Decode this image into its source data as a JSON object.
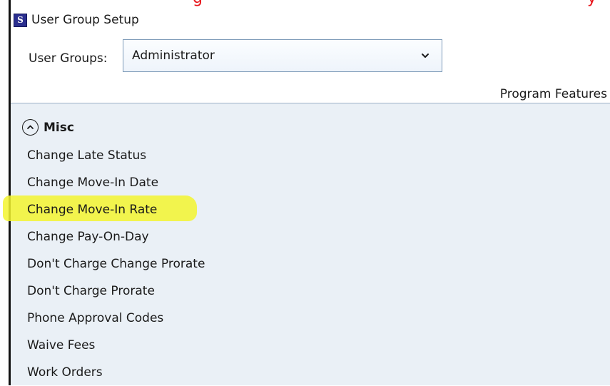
{
  "banner": {
    "text_left": "g",
    "text_right": "y"
  },
  "window": {
    "title": "User Group Setup",
    "logo_letter": "S"
  },
  "user_groups": {
    "label": "User Groups:",
    "selected": "Administrator"
  },
  "panel": {
    "column_header": "Program Features",
    "group": {
      "title": "Misc",
      "expanded": true,
      "items": [
        "Change Late Status",
        "Change Move-In Date",
        "Change Move-In Rate",
        "Change Pay-On-Day",
        "Don't Charge Change Prorate",
        "Don't Charge Prorate",
        "Phone Approval Codes",
        "Waive Fees",
        "Work Orders"
      ]
    }
  },
  "highlighted_item": "Change Move-In Rate",
  "colors": {
    "panel_background": "#eaf0f6",
    "highlight": "#f3f52f",
    "banner_text": "#e8151b",
    "logo_background": "#2b2f8f"
  },
  "icons": {
    "logo": "app-logo-icon",
    "dropdown": "chevron-down-icon",
    "collapse": "chevron-up-circle-icon"
  }
}
